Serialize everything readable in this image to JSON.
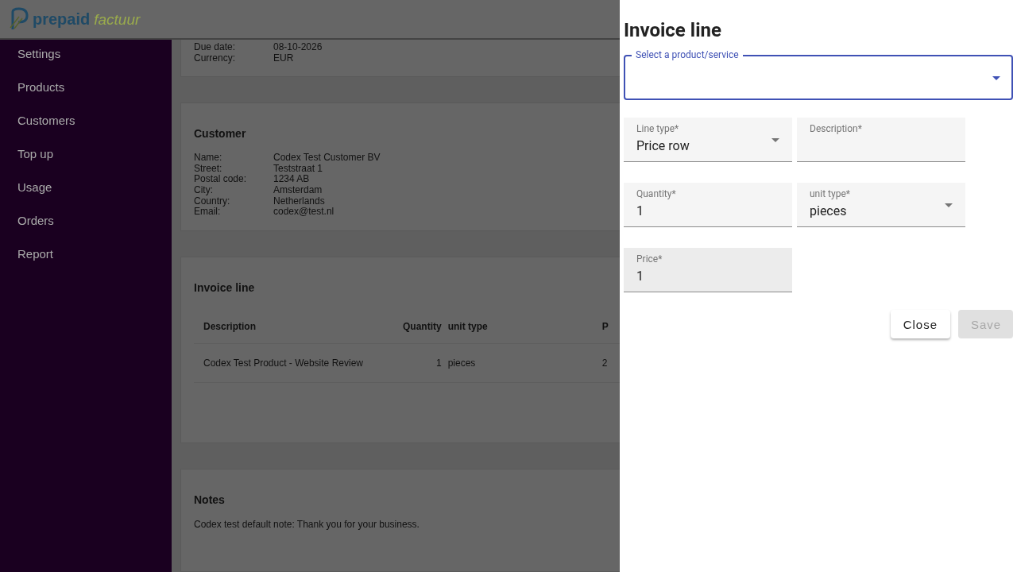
{
  "header": {
    "logo_brand": "prepaid",
    "logo_suffix": "factuur"
  },
  "sidebar": {
    "items": [
      {
        "label": "Settings"
      },
      {
        "label": "Products"
      },
      {
        "label": "Customers"
      },
      {
        "label": "Top up"
      },
      {
        "label": "Usage"
      },
      {
        "label": "Orders"
      },
      {
        "label": "Report"
      }
    ]
  },
  "order_card": {
    "rows": [
      {
        "label": "Due date:",
        "value": "08-10-2026"
      },
      {
        "label": "Currency:",
        "value": "EUR"
      }
    ]
  },
  "customer_card": {
    "title": "Customer",
    "rows": [
      {
        "label": "Name:",
        "value": "Codex Test Customer BV"
      },
      {
        "label": "Street:",
        "value": "Teststraat 1"
      },
      {
        "label": "Postal code:",
        "value": "1234 AB"
      },
      {
        "label": "City:",
        "value": "Amsterdam"
      },
      {
        "label": "Country:",
        "value": "Netherlands"
      },
      {
        "label": "Email:",
        "value": "codex@test.nl"
      }
    ]
  },
  "invoice_lines_card": {
    "title": "Invoice line",
    "columns": [
      "Description",
      "Quantity",
      "unit type",
      "P"
    ],
    "rows": [
      [
        "Codex Test Product - Website Review",
        "1",
        "pieces",
        "2"
      ]
    ]
  },
  "notes_card": {
    "title": "Notes",
    "text": "Codex test default note: Thank you for your business."
  },
  "drawer": {
    "title": "Invoice line",
    "product_select": {
      "label": "Select a product/service",
      "focused": true
    },
    "fields": [
      {
        "kind": "select",
        "label": "Line type*",
        "value": "Price row"
      },
      {
        "kind": "text",
        "label": "Description*"
      },
      {
        "kind": "text",
        "label": "Quantity*",
        "value": "1"
      },
      {
        "kind": "select",
        "label": "unit type*",
        "value": "pieces"
      },
      {
        "kind": "text",
        "label": "Price*",
        "value": "1"
      }
    ],
    "buttons": [
      {
        "label": "Close",
        "disabled": false
      },
      {
        "label": "Save",
        "disabled": true
      }
    ]
  }
}
